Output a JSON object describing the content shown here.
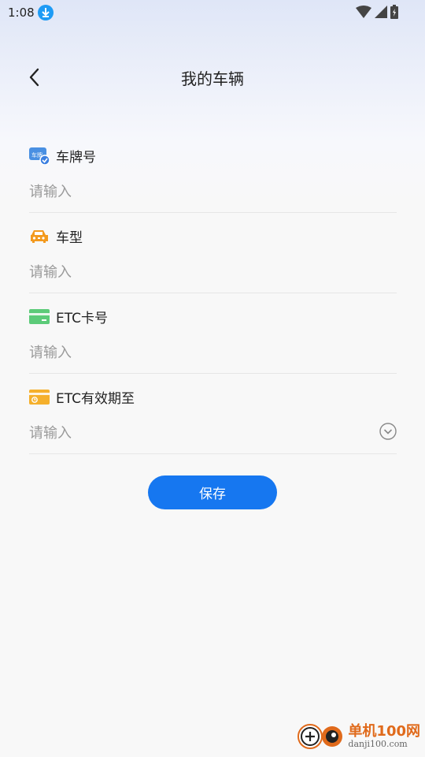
{
  "status_bar": {
    "time": "1:08"
  },
  "header": {
    "title": "我的车辆"
  },
  "fields": [
    {
      "label": "车牌号",
      "placeholder": "请输入",
      "icon": "license-plate-icon"
    },
    {
      "label": "车型",
      "placeholder": "请输入",
      "icon": "car-icon"
    },
    {
      "label": "ETC卡号",
      "placeholder": "请输入",
      "icon": "card-icon"
    },
    {
      "label": "ETC有效期至",
      "placeholder": "请输入",
      "icon": "card-calendar-icon"
    }
  ],
  "save_label": "保存",
  "watermark": {
    "title": "单机100网",
    "url": "danji100.com"
  },
  "colors": {
    "accent": "#1677f0",
    "plate_icon": "#4a90e2",
    "car_icon": "#f39a1e",
    "card_icon": "#5ccb79",
    "card_calendar_icon": "#f5b02c"
  }
}
